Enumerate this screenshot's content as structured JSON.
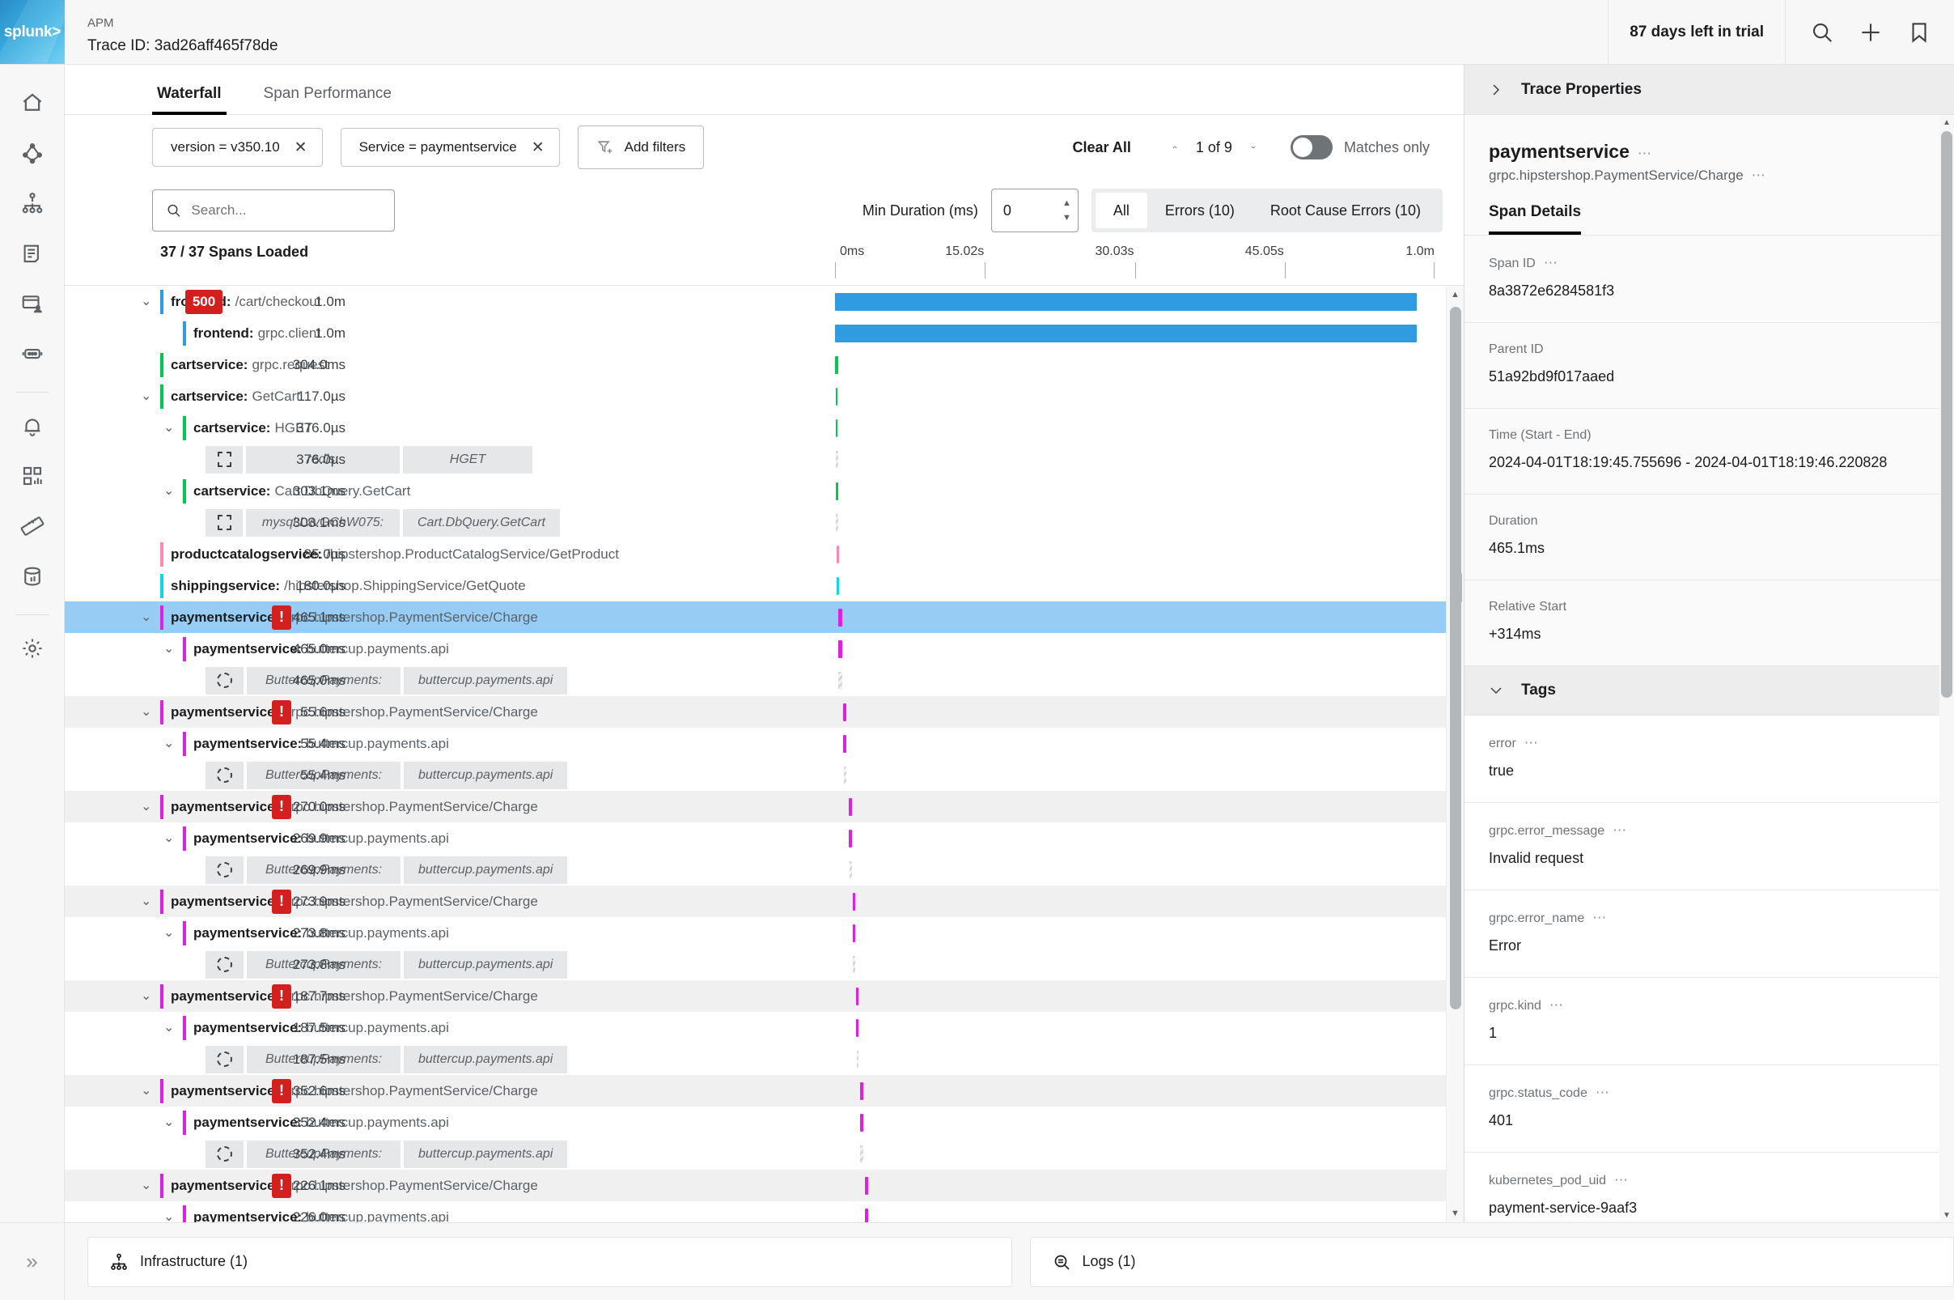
{
  "header": {
    "logo": "splunk>",
    "app_label": "APM",
    "trace_id": "Trace ID: 3ad26aff465f78de",
    "trial": "87 days left in trial",
    "icons": [
      "search-icon",
      "plus-icon",
      "bookmark-icon"
    ]
  },
  "sidebar": {
    "items": [
      {
        "name": "home-icon"
      },
      {
        "name": "apm-icon"
      },
      {
        "name": "service-map-icon"
      },
      {
        "name": "log-observer-icon"
      },
      {
        "name": "rum-icon"
      },
      {
        "name": "synthetics-icon"
      },
      {
        "name": "alerts-icon"
      },
      {
        "name": "dashboards-icon"
      },
      {
        "name": "metrics-icon"
      },
      {
        "name": "data-management-icon"
      },
      {
        "name": "settings-icon"
      }
    ],
    "expand_label": "»"
  },
  "tabs": [
    {
      "label": "Waterfall",
      "active": true
    },
    {
      "label": "Span Performance",
      "active": false
    }
  ],
  "filters": {
    "chips": [
      {
        "label": "version = v350.10",
        "close": "✕"
      },
      {
        "label": "Service = paymentservice",
        "close": "✕"
      }
    ],
    "add_filters": "Add filters",
    "clear_all": "Clear All",
    "nav_counter": "1 of 9",
    "up_chevron": "⌃",
    "down_chevron": "⌄",
    "matches_only": "Matches only",
    "toggle_on": false
  },
  "search": {
    "placeholder": "Search...",
    "value": "",
    "min_duration_label": "Min Duration (ms)",
    "min_duration_value": "0",
    "segments": [
      {
        "label": "All",
        "active": true
      },
      {
        "label": "Errors (10)",
        "active": false
      },
      {
        "label": "Root Cause Errors (10)",
        "active": false
      }
    ]
  },
  "waterfall": {
    "spans_loaded": "37 / 37 Spans Loaded",
    "ruler": [
      {
        "label": "0ms",
        "pos": 0
      },
      {
        "label": "15.02s",
        "pos": 25
      },
      {
        "label": "30.03s",
        "pos": 50
      },
      {
        "label": "45.05s",
        "pos": 75
      },
      {
        "label": "1.0m",
        "pos": 100
      }
    ],
    "rows": [
      {
        "depth": 0,
        "caret": "⌄",
        "service": "frontend",
        "op": "/cart/checkout",
        "duration": "1.0m",
        "color": "#2f9be0",
        "badge": "500",
        "badge_type": "500",
        "bar": {
          "start": 0,
          "width": 100,
          "kind": "solid"
        },
        "zebra": false,
        "selected": false
      },
      {
        "depth": 1,
        "caret": "",
        "service": "frontend",
        "op": "grpc.client",
        "duration": "1.0m",
        "color": "#2f9be0",
        "badge": "",
        "badge_type": "",
        "bar": {
          "start": 0,
          "width": 100,
          "kind": "solid"
        },
        "zebra": false,
        "selected": false
      },
      {
        "depth": 0,
        "caret": "",
        "service": "cartservice",
        "op": "grpc.request",
        "duration": "304.0ms",
        "color": "#00c853",
        "badge": "",
        "badge_type": "",
        "bar": {
          "start": 0,
          "width": 0.55,
          "kind": "solid"
        },
        "zebra": false,
        "selected": false
      },
      {
        "depth": 0,
        "caret": "⌄",
        "service": "cartservice",
        "op": "GetCart",
        "duration": "117.0µs",
        "color": "#00c853",
        "badge": "",
        "badge_type": "",
        "bar": {
          "start": 0.1,
          "width": 0.3,
          "kind": "solid"
        },
        "zebra": false,
        "selected": false
      },
      {
        "depth": 1,
        "caret": "⌄",
        "service": "cartservice",
        "op": "HGET",
        "duration": "376.0µs",
        "color": "#00c853",
        "badge": "",
        "badge_type": "",
        "bar": {
          "start": 0.1,
          "width": 0.3,
          "kind": "solid"
        },
        "zebra": false,
        "selected": false
      },
      {
        "depth": 2,
        "caret": "",
        "inferred": true,
        "infer_icon": "square",
        "infer_service": "redis:",
        "infer_op": "HGET",
        "duration": "376.0µs",
        "color": "#bdc1c4",
        "badge": "",
        "badge_type": "",
        "bar": {
          "start": 0.15,
          "width": 0.28,
          "kind": "hatch"
        },
        "zebra": false,
        "selected": false
      },
      {
        "depth": 1,
        "caret": "⌄",
        "service": "cartservice",
        "op": "Cart.DbQuery.GetCart",
        "duration": "303.1ms",
        "color": "#00c853",
        "badge": "",
        "badge_type": "",
        "bar": {
          "start": 0.1,
          "width": 0.5,
          "kind": "solid"
        },
        "zebra": false,
        "selected": false
      },
      {
        "depth": 2,
        "caret": "",
        "inferred": true,
        "infer_icon": "square",
        "infer_service": "mysql:LxvGChW075:",
        "infer_op": "Cart.DbQuery.GetCart",
        "duration": "303.1ms",
        "color": "#bdc1c4",
        "badge": "",
        "badge_type": "",
        "bar": {
          "start": 0.15,
          "width": 0.3,
          "kind": "hatch"
        },
        "zebra": false,
        "selected": false
      },
      {
        "depth": 0,
        "caret": "",
        "service": "productcatalogservice",
        "op": "/hipstershop.ProductCatalogService/GetProduct",
        "duration": "85.0µs",
        "color": "#ff89b0",
        "badge": "",
        "badge_type": "",
        "bar": {
          "start": 0.25,
          "width": 0.25,
          "kind": "solid"
        },
        "zebra": false,
        "selected": false
      },
      {
        "depth": 0,
        "caret": "",
        "service": "shippingservice",
        "op": "/hipstershop.ShippingService/GetQuote",
        "duration": "180.0µs",
        "color": "#0fd8e8",
        "badge": "",
        "badge_type": "",
        "bar": {
          "start": 0.3,
          "width": 0.25,
          "kind": "solid"
        },
        "zebra": false,
        "selected": false
      },
      {
        "depth": 0,
        "caret": "⌄",
        "service": "paymentservice",
        "op": "grpc.hipstershop.PaymentService/Charge",
        "duration": "465.1ms",
        "color": "#e020e0",
        "badge": "!",
        "badge_type": "bang",
        "bar": {
          "start": 0.55,
          "width": 0.75,
          "kind": "solid"
        },
        "zebra": false,
        "selected": true
      },
      {
        "depth": 1,
        "caret": "⌄",
        "service": "paymentservice",
        "op": "buttercup.payments.api",
        "duration": "465.0ms",
        "color": "#e020e0",
        "badge": "",
        "badge_type": "",
        "bar": {
          "start": 0.55,
          "width": 0.75,
          "kind": "solid"
        },
        "zebra": false,
        "selected": false
      },
      {
        "depth": 2,
        "caret": "",
        "inferred": true,
        "infer_icon": "circle",
        "infer_service": "ButtercupPayments:",
        "infer_op": "buttercup.payments.api",
        "duration": "465.0ms",
        "color": "#bdc1c4",
        "badge": "",
        "badge_type": "",
        "bar": {
          "start": 0.6,
          "width": 0.7,
          "kind": "hatch"
        },
        "zebra": false,
        "selected": false
      },
      {
        "depth": 0,
        "caret": "⌄",
        "service": "paymentservice",
        "op": "grpc.hipstershop.PaymentService/Charge",
        "duration": "55.6ms",
        "color": "#e020e0",
        "badge": "!",
        "badge_type": "bang",
        "bar": {
          "start": 1.45,
          "width": 0.45,
          "kind": "solid"
        },
        "zebra": true,
        "selected": false
      },
      {
        "depth": 1,
        "caret": "⌄",
        "service": "paymentservice",
        "op": "buttercup.payments.api",
        "duration": "55.4ms",
        "color": "#e020e0",
        "badge": "",
        "badge_type": "",
        "bar": {
          "start": 1.45,
          "width": 0.45,
          "kind": "solid"
        },
        "zebra": false,
        "selected": false
      },
      {
        "depth": 2,
        "caret": "",
        "inferred": true,
        "infer_icon": "circle",
        "infer_service": "ButtercupPayments:",
        "infer_op": "buttercup.payments.api",
        "duration": "55.4ms",
        "color": "#bdc1c4",
        "badge": "",
        "badge_type": "",
        "bar": {
          "start": 1.5,
          "width": 0.4,
          "kind": "hatch"
        },
        "zebra": false,
        "selected": false
      },
      {
        "depth": 0,
        "caret": "⌄",
        "service": "paymentservice",
        "op": "grpc.hipstershop.PaymentService/Charge",
        "duration": "270.0ms",
        "color": "#e020e0",
        "badge": "!",
        "badge_type": "bang",
        "bar": {
          "start": 2.4,
          "width": 0.5,
          "kind": "solid"
        },
        "zebra": true,
        "selected": false
      },
      {
        "depth": 1,
        "caret": "⌄",
        "service": "paymentservice",
        "op": "buttercup.payments.api",
        "duration": "269.9ms",
        "color": "#e020e0",
        "badge": "",
        "badge_type": "",
        "bar": {
          "start": 2.4,
          "width": 0.5,
          "kind": "solid"
        },
        "zebra": false,
        "selected": false
      },
      {
        "depth": 2,
        "caret": "",
        "inferred": true,
        "infer_icon": "circle",
        "infer_service": "ButtercupPayments:",
        "infer_op": "buttercup.payments.api",
        "duration": "269.9ms",
        "color": "#bdc1c4",
        "badge": "",
        "badge_type": "",
        "bar": {
          "start": 2.45,
          "width": 0.45,
          "kind": "hatch"
        },
        "zebra": false,
        "selected": false
      },
      {
        "depth": 0,
        "caret": "⌄",
        "service": "paymentservice",
        "op": "grpc.hipstershop.PaymentService/Charge",
        "duration": "273.9ms",
        "color": "#e020e0",
        "badge": "!",
        "badge_type": "bang",
        "bar": {
          "start": 3.0,
          "width": 0.5,
          "kind": "solid"
        },
        "zebra": true,
        "selected": false
      },
      {
        "depth": 1,
        "caret": "⌄",
        "service": "paymentservice",
        "op": "buttercup.payments.api",
        "duration": "273.8ms",
        "color": "#e020e0",
        "badge": "",
        "badge_type": "",
        "bar": {
          "start": 3.0,
          "width": 0.5,
          "kind": "solid"
        },
        "zebra": false,
        "selected": false
      },
      {
        "depth": 2,
        "caret": "",
        "inferred": true,
        "infer_icon": "circle",
        "infer_service": "ButtercupPayments:",
        "infer_op": "buttercup.payments.api",
        "duration": "273.8ms",
        "color": "#bdc1c4",
        "badge": "",
        "badge_type": "",
        "bar": {
          "start": 3.05,
          "width": 0.45,
          "kind": "hatch"
        },
        "zebra": false,
        "selected": false
      },
      {
        "depth": 0,
        "caret": "⌄",
        "service": "paymentservice",
        "op": "grpc.hipstershop.PaymentService/Charge",
        "duration": "187.7ms",
        "color": "#e020e0",
        "badge": "!",
        "badge_type": "bang",
        "bar": {
          "start": 3.65,
          "width": 0.45,
          "kind": "solid"
        },
        "zebra": true,
        "selected": false
      },
      {
        "depth": 1,
        "caret": "⌄",
        "service": "paymentservice",
        "op": "buttercup.payments.api",
        "duration": "187.5ms",
        "color": "#e020e0",
        "badge": "",
        "badge_type": "",
        "bar": {
          "start": 3.65,
          "width": 0.45,
          "kind": "solid"
        },
        "zebra": false,
        "selected": false
      },
      {
        "depth": 2,
        "caret": "",
        "inferred": true,
        "infer_icon": "circle",
        "infer_service": "ButtercupPayments:",
        "infer_op": "buttercup.payments.api",
        "duration": "187.5ms",
        "color": "#bdc1c4",
        "badge": "",
        "badge_type": "",
        "bar": {
          "start": 3.7,
          "width": 0.4,
          "kind": "hatch"
        },
        "zebra": false,
        "selected": false
      },
      {
        "depth": 0,
        "caret": "⌄",
        "service": "paymentservice",
        "op": "grpc.hipstershop.PaymentService/Charge",
        "duration": "352.6ms",
        "color": "#e020e0",
        "badge": "!",
        "badge_type": "bang",
        "bar": {
          "start": 4.3,
          "width": 0.5,
          "kind": "solid"
        },
        "zebra": true,
        "selected": false
      },
      {
        "depth": 1,
        "caret": "⌄",
        "service": "paymentservice",
        "op": "buttercup.payments.api",
        "duration": "352.4ms",
        "color": "#e020e0",
        "badge": "",
        "badge_type": "",
        "bar": {
          "start": 4.3,
          "width": 0.5,
          "kind": "solid"
        },
        "zebra": false,
        "selected": false
      },
      {
        "depth": 2,
        "caret": "",
        "inferred": true,
        "infer_icon": "circle",
        "infer_service": "ButtercupPayments:",
        "infer_op": "buttercup.payments.api",
        "duration": "352.4ms",
        "color": "#bdc1c4",
        "badge": "",
        "badge_type": "",
        "bar": {
          "start": 4.35,
          "width": 0.45,
          "kind": "hatch"
        },
        "zebra": false,
        "selected": false
      },
      {
        "depth": 0,
        "caret": "⌄",
        "service": "paymentservice",
        "op": "grpc.hipstershop.PaymentService/Charge",
        "duration": "226.1ms",
        "color": "#e020e0",
        "badge": "!",
        "badge_type": "bang",
        "bar": {
          "start": 5.2,
          "width": 0.45,
          "kind": "solid"
        },
        "zebra": true,
        "selected": false
      },
      {
        "depth": 1,
        "caret": "⌄",
        "service": "paymentservice",
        "op": "buttercup.payments.api",
        "duration": "226.0ms",
        "color": "#e020e0",
        "badge": "",
        "badge_type": "",
        "bar": {
          "start": 5.2,
          "width": 0.45,
          "kind": "solid"
        },
        "zebra": false,
        "selected": false
      }
    ]
  },
  "right_panel": {
    "trace_properties_label": "Trace Properties",
    "service_name": "paymentservice",
    "operation": "grpc.hipstershop.PaymentService/Charge",
    "span_details_tab": "Span Details",
    "fields": [
      {
        "key": "Span ID",
        "value": "8a3872e6284581f3",
        "dots": true
      },
      {
        "key": "Parent ID",
        "value": "51a92bd9f017aaed",
        "dots": false
      },
      {
        "key": "Time (Start - End)",
        "value": "2024-04-01T18:19:45.755696 - 2024-04-01T18:19:46.220828",
        "dots": false
      },
      {
        "key": "Duration",
        "value": "465.1ms",
        "dots": false
      },
      {
        "key": "Relative Start",
        "value": "+314ms",
        "dots": false
      }
    ],
    "tags_label": "Tags",
    "tags": [
      {
        "key": "error",
        "value": "true"
      },
      {
        "key": "grpc.error_message",
        "value": "Invalid request"
      },
      {
        "key": "grpc.error_name",
        "value": "Error"
      },
      {
        "key": "grpc.kind",
        "value": "1"
      },
      {
        "key": "grpc.status_code",
        "value": "401"
      },
      {
        "key": "kubernetes_pod_uid",
        "value": "payment-service-9aaf3"
      }
    ]
  },
  "bottom": {
    "infrastructure": "Infrastructure (1)",
    "logs": "Logs (1)",
    "expand": "»"
  },
  "colors": {
    "brand": "#1ba0dc",
    "error": "#d41f1f",
    "selected_row": "#97cdf5",
    "frontend": "#2f9be0",
    "cartservice": "#00c853",
    "paymentservice": "#e020e0",
    "productcatalogservice": "#ff89b0",
    "shippingservice": "#0fd8e8"
  }
}
